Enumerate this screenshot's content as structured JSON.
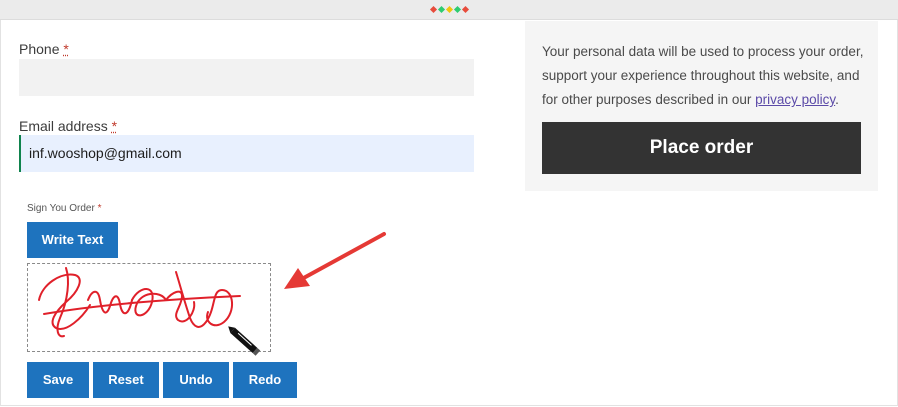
{
  "phone": {
    "label": "Phone",
    "required_mark": "*",
    "value": ""
  },
  "email": {
    "label": "Email address",
    "required_mark": "*",
    "value": "inf.wooshop@gmail.com"
  },
  "signature": {
    "label": "Sign You Order",
    "required_mark": "*",
    "write_text_button": "Write Text",
    "actions": {
      "save": "Save",
      "reset": "Reset",
      "undo": "Undo",
      "redo": "Redo"
    }
  },
  "sidebar": {
    "privacy_text": "Your personal data will be used to process your order, support your experience throughout this website, and for other purposes described in our",
    "privacy_link": "privacy policy",
    "privacy_end": ".",
    "place_order": "Place order"
  },
  "colors": {
    "accent_blue": "#1e73be",
    "place_order_bg": "#333333",
    "annotation_arrow": "#e53935",
    "signature_ink": "#e0202a"
  }
}
